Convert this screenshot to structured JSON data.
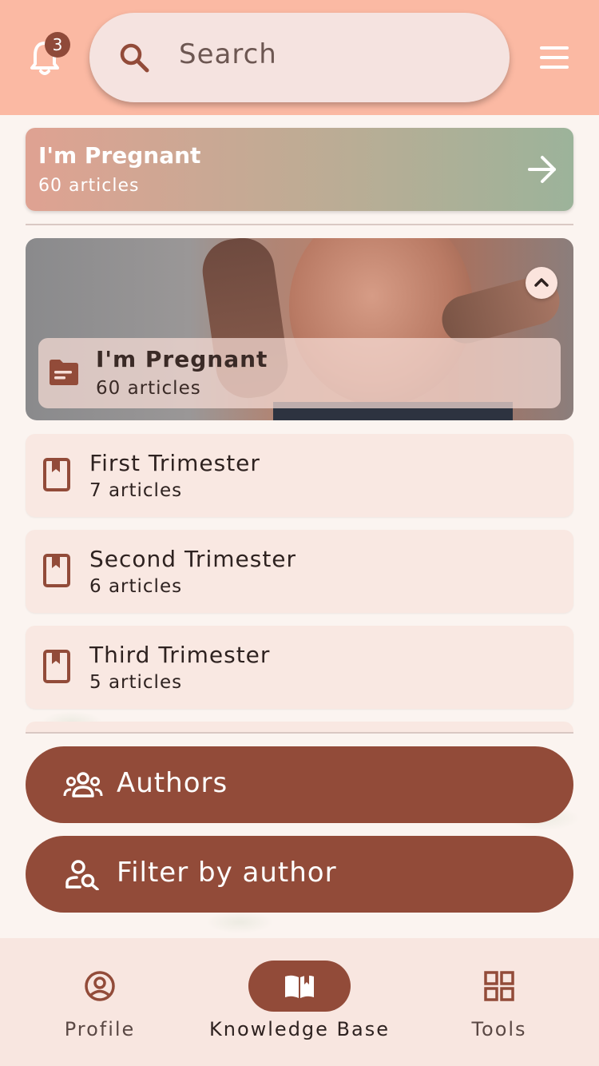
{
  "header": {
    "notifications_count": "3",
    "search_placeholder": "Search",
    "bell_icon": "bell-icon",
    "menu_icon": "hamburger-menu-icon"
  },
  "category_card": {
    "title": "I'm Pregnant",
    "count": "60 articles",
    "icon": "arrow-right-icon"
  },
  "hero": {
    "title": "I'm Pregnant",
    "count": "60 articles",
    "icon": "folder-icon",
    "collapse_icon": "chevron-up-icon"
  },
  "subcategories": [
    {
      "title": "First Trimester",
      "count": "7 articles",
      "icon": "bookmark-book-icon"
    },
    {
      "title": "Second Trimester",
      "count": "6 articles",
      "icon": "bookmark-book-icon"
    },
    {
      "title": "Third Trimester",
      "count": "5 articles",
      "icon": "bookmark-book-icon"
    }
  ],
  "buttons": {
    "authors": "Authors",
    "filter_by_author": "Filter by author"
  },
  "bottom_nav": [
    {
      "label": "Profile",
      "icon": "account-circle-icon",
      "active": false
    },
    {
      "label": "Knowledge Base",
      "icon": "open-book-icon",
      "active": true
    },
    {
      "label": "Tools",
      "icon": "grid-icon",
      "active": false
    }
  ],
  "colors": {
    "header_bg": "#fbb9a3",
    "accent": "#924b39",
    "card_bg": "#f9e8e2",
    "nav_bg": "#f8e6e0"
  }
}
